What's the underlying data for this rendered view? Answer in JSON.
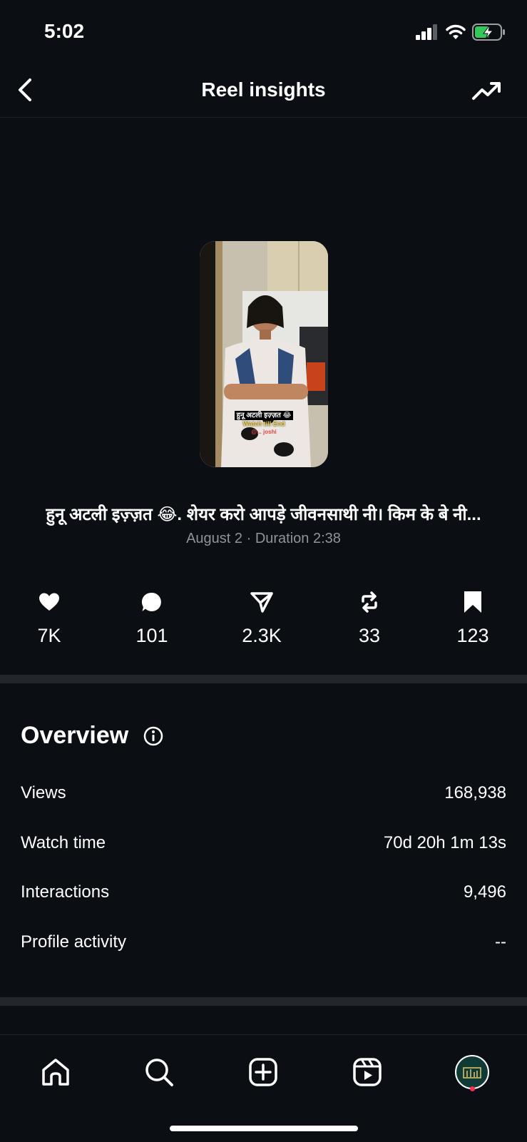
{
  "status": {
    "time": "5:02"
  },
  "header": {
    "title": "Reel insights"
  },
  "reel": {
    "overlay_line1": "हुनू अटली इज़्ज़त 😂",
    "overlay_line2": "Watch till End",
    "overlay_line3": "@... joshi",
    "caption": "हुनू अटली इज़्ज़त 😂. शेयर करो आपड़े जीवनसाथी नी। किम के बे नी...",
    "meta": "August 2 · Duration 2:38"
  },
  "stats": [
    {
      "icon": "heart-icon",
      "value": "7K"
    },
    {
      "icon": "comment-icon",
      "value": "101"
    },
    {
      "icon": "share-icon",
      "value": "2.3K"
    },
    {
      "icon": "repost-icon",
      "value": "33"
    },
    {
      "icon": "bookmark-icon",
      "value": "123"
    }
  ],
  "overview": {
    "title": "Overview",
    "rows": [
      {
        "label": "Views",
        "value": "168,938"
      },
      {
        "label": "Watch time",
        "value": "70d 20h 1m 13s"
      },
      {
        "label": "Interactions",
        "value": "9,496"
      },
      {
        "label": "Profile activity",
        "value": "--"
      }
    ]
  },
  "tabs": [
    "home-icon",
    "search-icon",
    "create-icon",
    "reels-icon",
    "profile-avatar"
  ],
  "colors": {
    "background": "#0b0f14",
    "secondary_text": "#8e9499",
    "divider": "#22272c",
    "notification_dot": "#ff2d55"
  }
}
